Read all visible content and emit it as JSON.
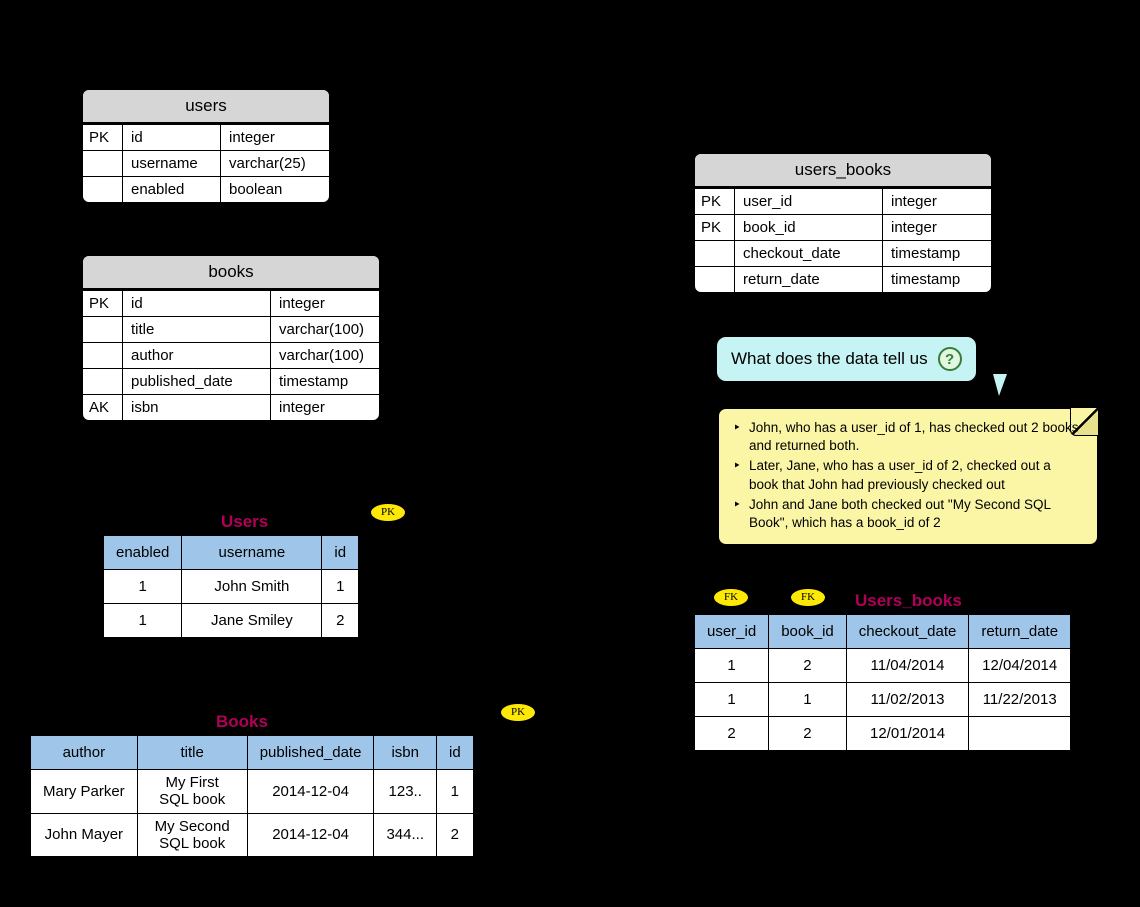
{
  "schemas": {
    "users": {
      "title": "users",
      "rows": [
        {
          "key": "PK",
          "name": "id",
          "type": "integer"
        },
        {
          "key": "",
          "name": "username",
          "type": "varchar(25)"
        },
        {
          "key": "",
          "name": "enabled",
          "type": "boolean"
        }
      ]
    },
    "books": {
      "title": "books",
      "rows": [
        {
          "key": "PK",
          "name": "id",
          "type": "integer"
        },
        {
          "key": "",
          "name": "title",
          "type": "varchar(100)"
        },
        {
          "key": "",
          "name": "author",
          "type": "varchar(100)"
        },
        {
          "key": "",
          "name": "published_date",
          "type": "timestamp"
        },
        {
          "key": "AK",
          "name": "isbn",
          "type": "integer"
        }
      ]
    },
    "users_books": {
      "title": "users_books",
      "rows": [
        {
          "key": "PK",
          "name": "user_id",
          "type": "integer"
        },
        {
          "key": "PK",
          "name": "book_id",
          "type": "integer"
        },
        {
          "key": "",
          "name": "checkout_date",
          "type": "timestamp"
        },
        {
          "key": "",
          "name": "return_date",
          "type": "timestamp"
        }
      ]
    }
  },
  "data_tables": {
    "users": {
      "caption": "Users",
      "pk_badge": "PK",
      "headers": [
        "enabled",
        "username",
        "id"
      ],
      "rows": [
        [
          "1",
          "John Smith",
          "1"
        ],
        [
          "1",
          "Jane Smiley",
          "2"
        ]
      ]
    },
    "books": {
      "caption": "Books",
      "pk_badge": "PK",
      "headers": [
        "author",
        "title",
        "published_date",
        "isbn",
        "id"
      ],
      "rows": [
        [
          "Mary Parker",
          "My First SQL book",
          "2014-12-04",
          "123..",
          "1"
        ],
        [
          "John Mayer",
          "My Second SQL book",
          "2014-12-04",
          "344...",
          "2"
        ]
      ]
    },
    "users_books": {
      "caption": "Users_books",
      "fk_badges": [
        "FK",
        "FK"
      ],
      "headers": [
        "user_id",
        "book_id",
        "checkout_date",
        "return_date"
      ],
      "rows": [
        [
          "1",
          "2",
          "11/04/2014",
          "12/04/2014"
        ],
        [
          "1",
          "1",
          "11/02/2013",
          "11/22/2013"
        ],
        [
          "2",
          "2",
          "12/01/2014",
          ""
        ]
      ]
    }
  },
  "callout": {
    "text": "What does the data tell us",
    "icon": "?"
  },
  "note": {
    "items": [
      "John, who has a user_id of 1, has checked out 2 books and returned both.",
      "Later, Jane, who has a user_id of 2, checked out a book that John had previously checked out",
      "John and Jane both checked out \"My Second SQL Book\", which has a book_id of 2"
    ]
  }
}
